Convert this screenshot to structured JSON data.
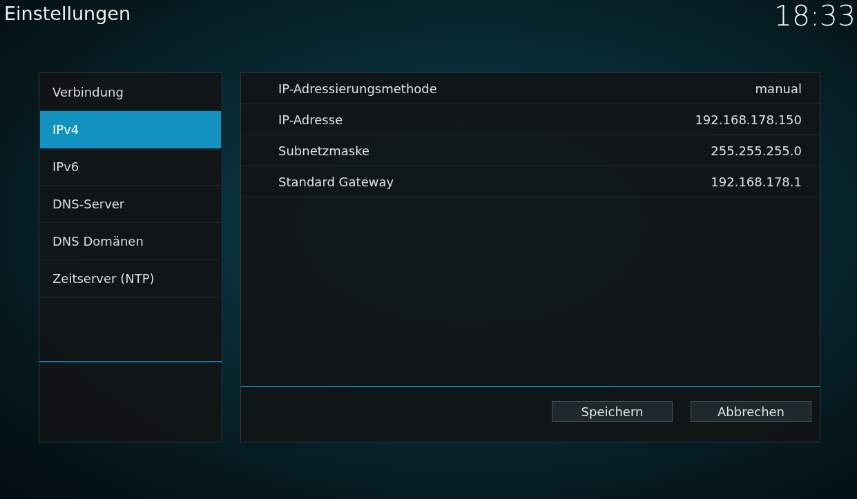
{
  "window": {
    "title": "Einstellungen",
    "clock": "18:33"
  },
  "sidebar": {
    "items": [
      {
        "label": "Verbindung",
        "selected": false
      },
      {
        "label": "IPv4",
        "selected": true
      },
      {
        "label": "IPv6",
        "selected": false
      },
      {
        "label": "DNS-Server",
        "selected": false
      },
      {
        "label": "DNS Domänen",
        "selected": false
      },
      {
        "label": "Zeitserver (NTP)",
        "selected": false
      }
    ]
  },
  "settings": [
    {
      "label": "IP-Adressierungsmethode",
      "value": "manual"
    },
    {
      "label": "IP-Adresse",
      "value": "192.168.178.150"
    },
    {
      "label": "Subnetzmaske",
      "value": "255.255.255.0"
    },
    {
      "label": "Standard Gateway",
      "value": "192.168.178.1"
    }
  ],
  "buttons": [
    "Speichern",
    "Abbrechen"
  ]
}
